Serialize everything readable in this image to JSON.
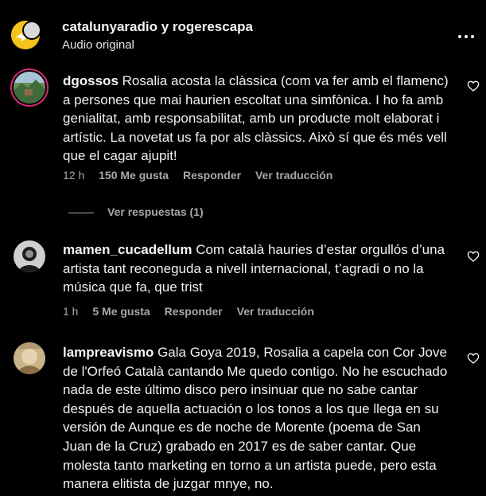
{
  "header": {
    "title": "catalunyaradio y rogerescapa",
    "subtitle": "Audio original",
    "more_icon": "more-horizontal-icon"
  },
  "comments": [
    {
      "username": "dgossos",
      "text": "Rosalia acosta la clàssica (com va fer amb el flamenc) a persones que mai haurien escoltat una simfònica. I ho fa amb genialitat, amb responsabilitat, amb un producte molt elaborat i artístic. La novetat us fa por als clàssics. Això sí que és més vell que el cagar ajupit!",
      "time": "12 h",
      "likes": "150 Me gusta",
      "reply": "Responder",
      "translate": "Ver traducción",
      "view_replies": "Ver respuestas (1)"
    },
    {
      "username": "mamen_cucadellum",
      "text": "Com català hauries d’estar orgullós d’una artista tant reconeguda a nivell internacional, t’agradi o no la música que fa, que trist",
      "time": "1 h",
      "likes": "5 Me gusta",
      "reply": "Responder",
      "translate": "Ver traducción"
    },
    {
      "username": "lampreavismo",
      "text": "Gala Goya 2019, Rosalia a capela con Cor Jove de l'Orfeó Català cantando Me quedo contigo. No he escuchado nada de este último disco pero insinuar que no sabe cantar después de aquella actuación o los tonos a los que llega en su versión de Aunque es de noche de Morente (poema de San Juan de la Cruz) grabado en 2017 es de saber cantar. Que molesta tanto marketing en torno a un artista puede, pero esta manera elitista de juzgar mnye, no."
    }
  ],
  "icons": {
    "like": "heart-outline-icon"
  },
  "colors": {
    "background": "#000000",
    "text": "#f5f5f5",
    "meta": "#a8a8a8",
    "story_ring": "#d62976"
  }
}
